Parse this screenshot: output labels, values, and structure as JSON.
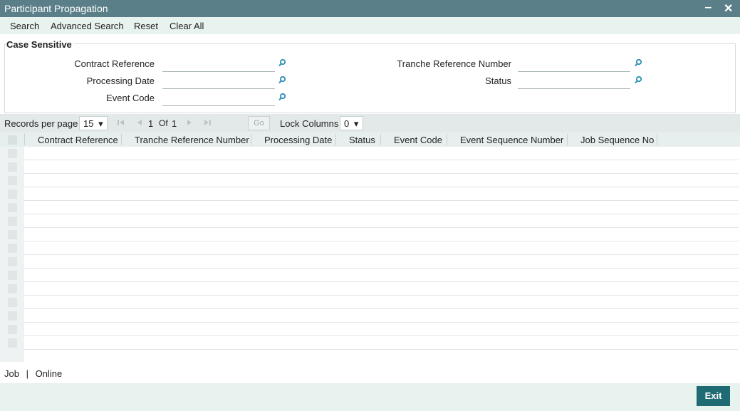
{
  "window": {
    "title": "Participant Propagation",
    "min_glyph": "‒",
    "close_glyph": "✕"
  },
  "toolbar": {
    "search": "Search",
    "advanced_search": "Advanced Search",
    "reset": "Reset",
    "clear_all": "Clear All"
  },
  "criteria": {
    "legend": "Case Sensitive",
    "contract_reference": {
      "label": "Contract Reference",
      "value": ""
    },
    "processing_date": {
      "label": "Processing Date",
      "value": ""
    },
    "event_code": {
      "label": "Event Code",
      "value": ""
    },
    "tranche_reference_number": {
      "label": "Tranche Reference Number",
      "value": ""
    },
    "status": {
      "label": "Status",
      "value": ""
    }
  },
  "pager": {
    "records_per_page_label": "Records per page",
    "records_per_page": "15",
    "current_page": "1",
    "of_label": "Of",
    "total_pages": "1",
    "go": "Go",
    "lock_columns_label": "Lock Columns",
    "lock_columns": "0",
    "dropdown_glyph": "▾"
  },
  "grid": {
    "columns": [
      "Contract Reference",
      "Tranche Reference Number",
      "Processing Date",
      "Status",
      "Event Code",
      "Event Sequence Number",
      "Job Sequence No"
    ],
    "rows": []
  },
  "footer": {
    "job": "Job",
    "separator": "|",
    "online": "Online"
  },
  "exit": "Exit",
  "colors": {
    "titlebar": "#5b7f88",
    "toolbar": "#e8f2ee",
    "accent": "#1f6b73",
    "lookup": "#2a8fb5"
  }
}
